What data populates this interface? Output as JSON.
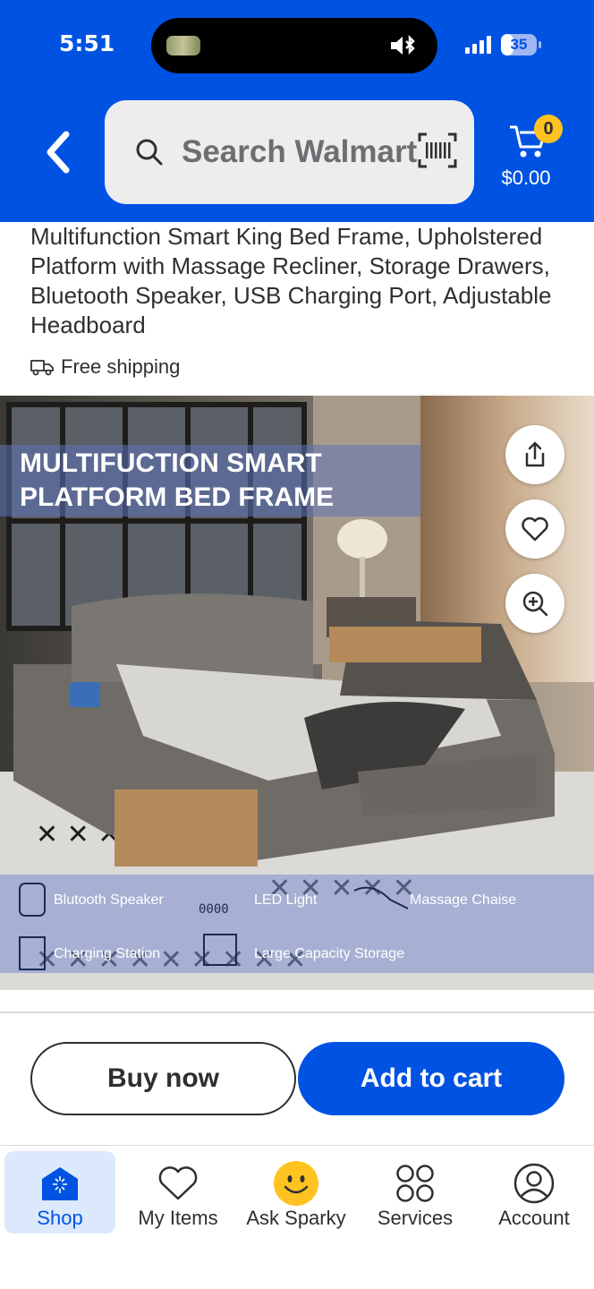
{
  "status_bar": {
    "time": "5:51",
    "battery": "35",
    "battery_level": 0.35
  },
  "header": {
    "search_placeholder": "Search Walmart",
    "cart_count": "0",
    "cart_total": "$0.00"
  },
  "product": {
    "title": "Multifunction Smart King Bed Frame, Upholstered Platform with Massage Recliner, Storage Drawers, Bluetooth Speaker, USB Charging Port, Adjustable Headboard",
    "shipping": "Free shipping",
    "image": {
      "headline_line1": "MULTIFUCTION SMART",
      "headline_line2": "PLATFORM BED FRAME",
      "features": [
        "Blutooth Speaker",
        "LED Light",
        "Massage Chaise",
        "Charging Station",
        "Large Capacity Storage"
      ]
    }
  },
  "actions": {
    "buy_now": "Buy now",
    "add_to_cart": "Add to cart"
  },
  "tabs": [
    {
      "label": "Shop",
      "icon": "shop-icon",
      "active": true
    },
    {
      "label": "My Items",
      "icon": "heart-icon",
      "active": false
    },
    {
      "label": "Ask Sparky",
      "icon": "sparky-icon",
      "active": false
    },
    {
      "label": "Services",
      "icon": "services-icon",
      "active": false
    },
    {
      "label": "Account",
      "icon": "account-icon",
      "active": false
    }
  ],
  "colors": {
    "brand_blue": "#0053e2",
    "badge_yellow": "#ffc220",
    "tab_active_bg": "#dce9fc"
  }
}
